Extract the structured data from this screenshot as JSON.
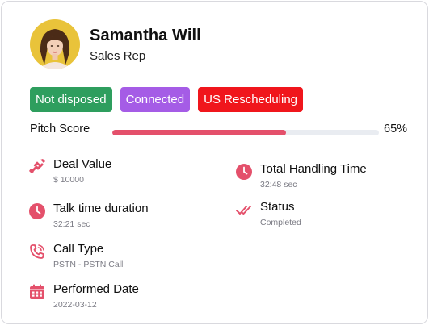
{
  "profile": {
    "name": "Samantha Will",
    "role": "Sales Rep"
  },
  "badges": [
    {
      "label": "Not disposed",
      "color": "#2e9e5e"
    },
    {
      "label": "Connected",
      "color": "#a55ce6"
    },
    {
      "label": "US Rescheduling",
      "color": "#f0161c"
    }
  ],
  "pitch": {
    "label": "Pitch Score",
    "value_text": "65%",
    "percent": 65,
    "fill_color": "#e4506b"
  },
  "details": {
    "deal_value": {
      "label": "Deal Value",
      "value": "$ 10000",
      "icon": "handshake-icon"
    },
    "total_handling_time": {
      "label": "Total Handling Time",
      "value": "32:48 sec",
      "icon": "clock-icon"
    },
    "talk_time_duration": {
      "label": "Talk time duration",
      "value": "32:21 sec",
      "icon": "clock-icon"
    },
    "status": {
      "label": "Status",
      "value": "Completed",
      "icon": "double-check-icon"
    },
    "call_type": {
      "label": "Call Type",
      "value": "PSTN - PSTN Call",
      "icon": "phone-icon"
    },
    "performed_date": {
      "label": "Performed Date",
      "value": "2022-03-12",
      "icon": "calendar-icon"
    }
  },
  "accent_color": "#e4506b"
}
